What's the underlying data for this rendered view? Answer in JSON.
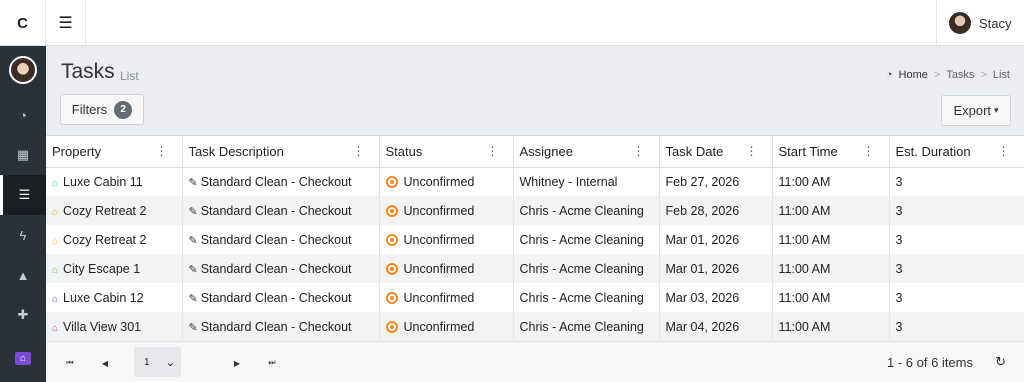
{
  "app": {
    "logo": "C"
  },
  "header": {
    "menu_icon": "hamburger-icon",
    "user_name": "Stacy"
  },
  "sidebar": {
    "items": [
      {
        "icon": "dashboard-icon",
        "glyph": "◔"
      },
      {
        "icon": "calendar-icon",
        "glyph": "▦"
      },
      {
        "icon": "list-icon",
        "glyph": "☰",
        "active": true
      },
      {
        "icon": "bolt-icon",
        "glyph": "ϟ"
      },
      {
        "icon": "warning-icon",
        "glyph": "▲"
      },
      {
        "icon": "plus-icon",
        "glyph": "✚"
      },
      {
        "icon": "home-icon",
        "glyph": "⌂"
      }
    ]
  },
  "page": {
    "title": "Tasks",
    "subtitle": "List",
    "breadcrumb": {
      "home": "Home",
      "section": "Tasks",
      "current": "List",
      "separator": ">"
    }
  },
  "toolbar": {
    "filters_label": "Filters",
    "filters_count": "2",
    "export_label": "Export"
  },
  "grid": {
    "columns": [
      "Property",
      "Task Description",
      "Status",
      "Assignee",
      "Task Date",
      "Start Time",
      "Est. Duration"
    ],
    "rows": [
      {
        "property": "Luxe Cabin 11",
        "house_color": "#3cc1d6",
        "task": "Standard Clean - Checkout",
        "status": "Unconfirmed",
        "assignee": "Whitney - Internal",
        "date": "Feb 27, 2026",
        "start": "11:00 AM",
        "duration": "3"
      },
      {
        "property": "Cozy Retreat 2",
        "house_color": "#f5b820",
        "task": "Standard Clean - Checkout",
        "status": "Unconfirmed",
        "assignee": "Chris - Acme Cleaning",
        "date": "Feb 28, 2026",
        "start": "11:00 AM",
        "duration": "3"
      },
      {
        "property": "Cozy Retreat 2",
        "house_color": "#f5b820",
        "task": "Standard Clean - Checkout",
        "status": "Unconfirmed",
        "assignee": "Chris - Acme Cleaning",
        "date": "Mar 01, 2026",
        "start": "11:00 AM",
        "duration": "3"
      },
      {
        "property": "City Escape 1",
        "house_color": "#7cc44a",
        "task": "Standard Clean - Checkout",
        "status": "Unconfirmed",
        "assignee": "Chris - Acme Cleaning",
        "date": "Mar 01, 2026",
        "start": "11:00 AM",
        "duration": "3"
      },
      {
        "property": "Luxe Cabin 12",
        "house_color": "#6a4fc7",
        "task": "Standard Clean - Checkout",
        "status": "Unconfirmed",
        "assignee": "Chris - Acme Cleaning",
        "date": "Mar 03, 2026",
        "start": "11:00 AM",
        "duration": "3"
      },
      {
        "property": "Villa View 301",
        "house_color": "#ec3fa0",
        "task": "Standard Clean - Checkout",
        "status": "Unconfirmed",
        "assignee": "Chris - Acme Cleaning",
        "date": "Mar 04, 2026",
        "start": "11:00 AM",
        "duration": "3"
      }
    ]
  },
  "pager": {
    "page_size": "1",
    "info": "1 - 6 of 6 items"
  },
  "colors": {
    "status_unconfirmed": "#f28a1b",
    "sidebar_bg": "#2a3138"
  }
}
